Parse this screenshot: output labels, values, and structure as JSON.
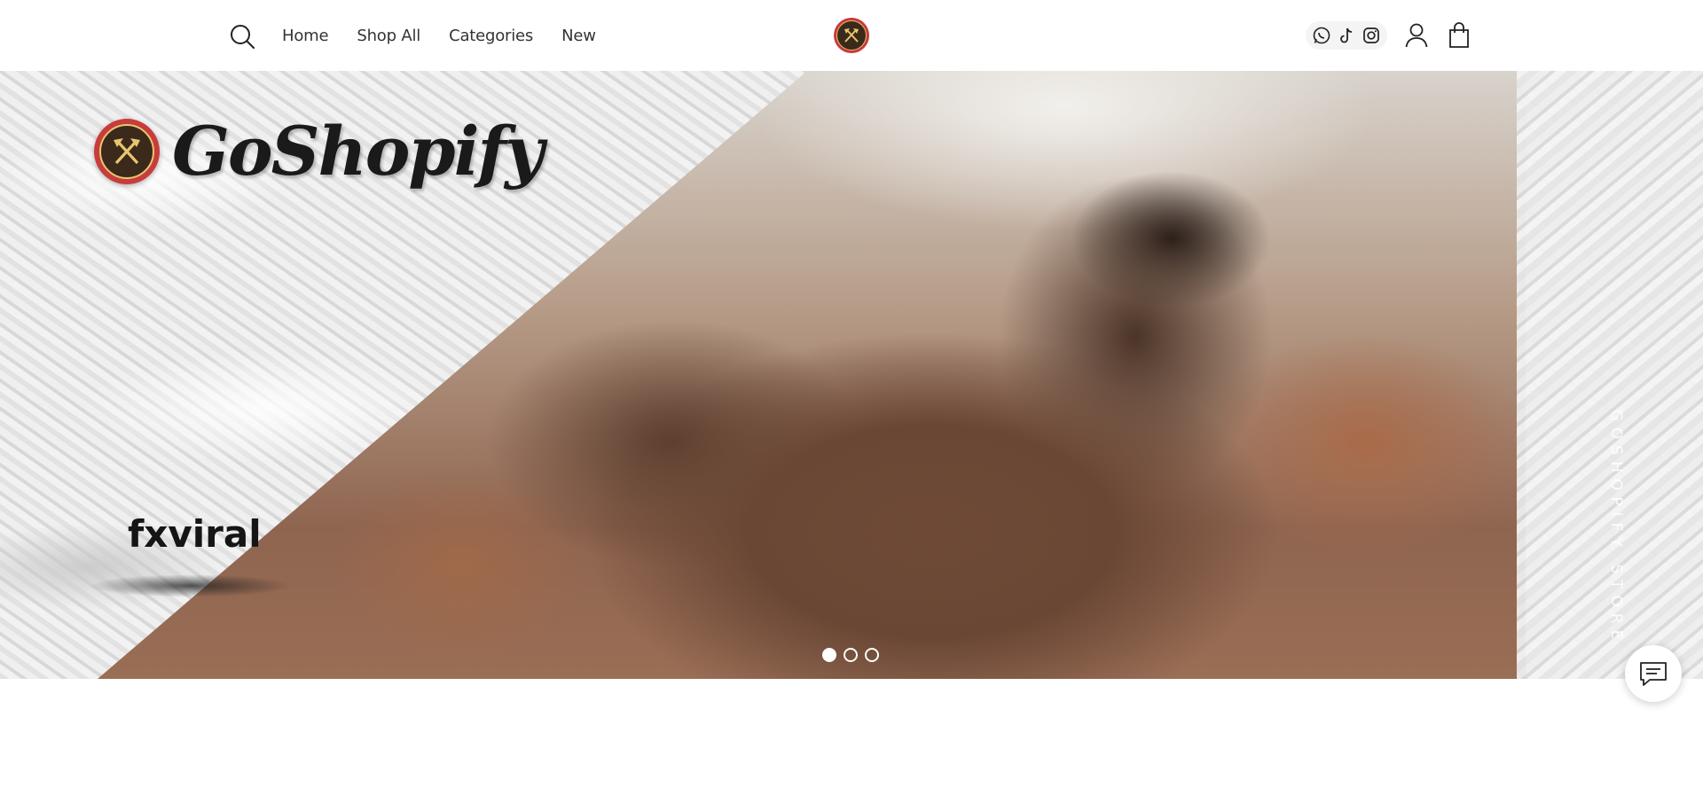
{
  "header": {
    "nav": [
      "Home",
      "Shop All",
      "Categories",
      "New"
    ],
    "icons": {
      "search": "search-icon",
      "logo": "crossed-axes-logo",
      "socials": [
        "whatsapp-icon",
        "tiktok-icon",
        "instagram-icon"
      ],
      "account": "user-icon",
      "cart": "shopping-bag-icon"
    }
  },
  "hero": {
    "brand_name": "GoShopify",
    "tagline": "fxviral",
    "vertical_text": "GOSHOPIFY STORE",
    "slides_total": 3,
    "active_slide": 1
  },
  "colors": {
    "logo_red": "#c83c3c",
    "logo_gold": "#e7c66f",
    "logo_dark": "#3b2a1b"
  },
  "chat": {
    "icon": "chat-bubble-icon"
  }
}
